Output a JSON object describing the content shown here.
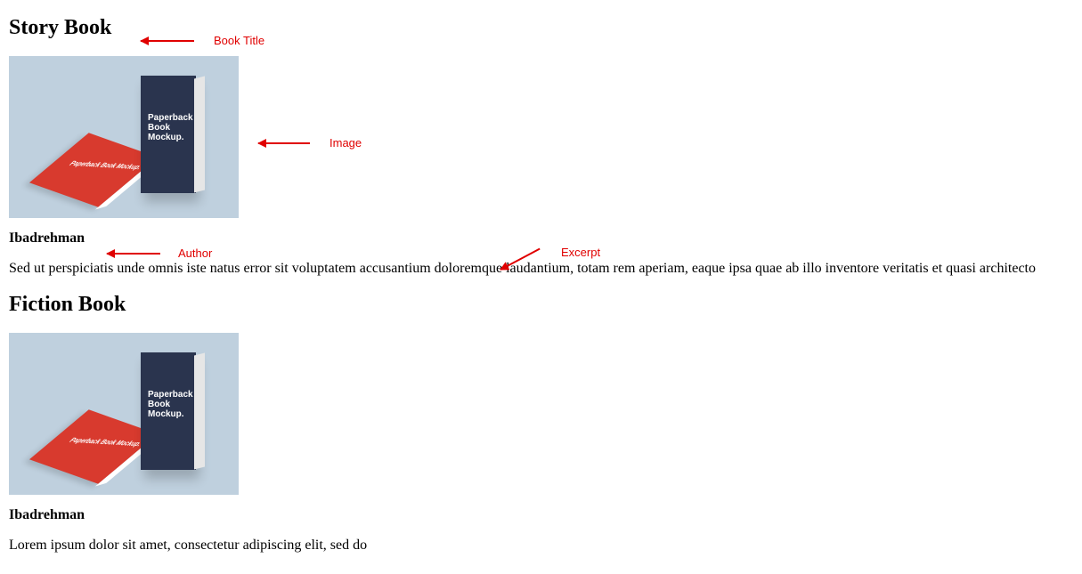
{
  "annotations": {
    "book_title": "Book Title",
    "image": "Image",
    "author": "Author",
    "excerpt": "Excerpt"
  },
  "image_text": {
    "red_label": "Paperback\nBook Mockup.",
    "navy_label": "Paperback\nBook\nMockup."
  },
  "books": [
    {
      "title": "Story Book",
      "author": "Ibadrehman",
      "excerpt": "Sed ut perspiciatis unde omnis iste natus error sit voluptatem accusantium doloremque laudantium, totam rem aperiam, eaque ipsa quae ab illo inventore veritatis et quasi architecto"
    },
    {
      "title": "Fiction Book",
      "author": "Ibadrehman",
      "excerpt": "Lorem ipsum dolor sit amet, consectetur adipiscing elit, sed do"
    }
  ]
}
